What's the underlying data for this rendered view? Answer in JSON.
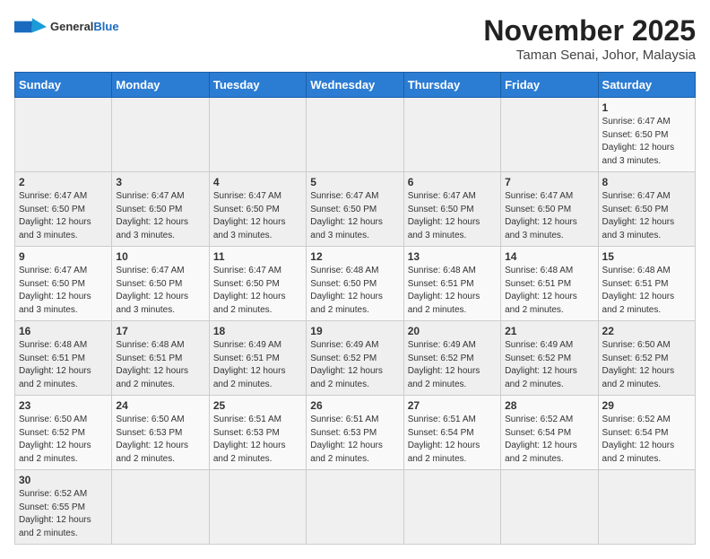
{
  "logo": {
    "text_general": "General",
    "text_blue": "Blue"
  },
  "title": {
    "month_year": "November 2025",
    "location": "Taman Senai, Johor, Malaysia"
  },
  "weekdays": [
    "Sunday",
    "Monday",
    "Tuesday",
    "Wednesday",
    "Thursday",
    "Friday",
    "Saturday"
  ],
  "weeks": [
    [
      {
        "day": "",
        "info": ""
      },
      {
        "day": "",
        "info": ""
      },
      {
        "day": "",
        "info": ""
      },
      {
        "day": "",
        "info": ""
      },
      {
        "day": "",
        "info": ""
      },
      {
        "day": "",
        "info": ""
      },
      {
        "day": "1",
        "info": "Sunrise: 6:47 AM\nSunset: 6:50 PM\nDaylight: 12 hours and 3 minutes."
      }
    ],
    [
      {
        "day": "2",
        "info": "Sunrise: 6:47 AM\nSunset: 6:50 PM\nDaylight: 12 hours and 3 minutes."
      },
      {
        "day": "3",
        "info": "Sunrise: 6:47 AM\nSunset: 6:50 PM\nDaylight: 12 hours and 3 minutes."
      },
      {
        "day": "4",
        "info": "Sunrise: 6:47 AM\nSunset: 6:50 PM\nDaylight: 12 hours and 3 minutes."
      },
      {
        "day": "5",
        "info": "Sunrise: 6:47 AM\nSunset: 6:50 PM\nDaylight: 12 hours and 3 minutes."
      },
      {
        "day": "6",
        "info": "Sunrise: 6:47 AM\nSunset: 6:50 PM\nDaylight: 12 hours and 3 minutes."
      },
      {
        "day": "7",
        "info": "Sunrise: 6:47 AM\nSunset: 6:50 PM\nDaylight: 12 hours and 3 minutes."
      },
      {
        "day": "8",
        "info": "Sunrise: 6:47 AM\nSunset: 6:50 PM\nDaylight: 12 hours and 3 minutes."
      }
    ],
    [
      {
        "day": "9",
        "info": "Sunrise: 6:47 AM\nSunset: 6:50 PM\nDaylight: 12 hours and 3 minutes."
      },
      {
        "day": "10",
        "info": "Sunrise: 6:47 AM\nSunset: 6:50 PM\nDaylight: 12 hours and 3 minutes."
      },
      {
        "day": "11",
        "info": "Sunrise: 6:47 AM\nSunset: 6:50 PM\nDaylight: 12 hours and 2 minutes."
      },
      {
        "day": "12",
        "info": "Sunrise: 6:48 AM\nSunset: 6:50 PM\nDaylight: 12 hours and 2 minutes."
      },
      {
        "day": "13",
        "info": "Sunrise: 6:48 AM\nSunset: 6:51 PM\nDaylight: 12 hours and 2 minutes."
      },
      {
        "day": "14",
        "info": "Sunrise: 6:48 AM\nSunset: 6:51 PM\nDaylight: 12 hours and 2 minutes."
      },
      {
        "day": "15",
        "info": "Sunrise: 6:48 AM\nSunset: 6:51 PM\nDaylight: 12 hours and 2 minutes."
      }
    ],
    [
      {
        "day": "16",
        "info": "Sunrise: 6:48 AM\nSunset: 6:51 PM\nDaylight: 12 hours and 2 minutes."
      },
      {
        "day": "17",
        "info": "Sunrise: 6:48 AM\nSunset: 6:51 PM\nDaylight: 12 hours and 2 minutes."
      },
      {
        "day": "18",
        "info": "Sunrise: 6:49 AM\nSunset: 6:51 PM\nDaylight: 12 hours and 2 minutes."
      },
      {
        "day": "19",
        "info": "Sunrise: 6:49 AM\nSunset: 6:52 PM\nDaylight: 12 hours and 2 minutes."
      },
      {
        "day": "20",
        "info": "Sunrise: 6:49 AM\nSunset: 6:52 PM\nDaylight: 12 hours and 2 minutes."
      },
      {
        "day": "21",
        "info": "Sunrise: 6:49 AM\nSunset: 6:52 PM\nDaylight: 12 hours and 2 minutes."
      },
      {
        "day": "22",
        "info": "Sunrise: 6:50 AM\nSunset: 6:52 PM\nDaylight: 12 hours and 2 minutes."
      }
    ],
    [
      {
        "day": "23",
        "info": "Sunrise: 6:50 AM\nSunset: 6:52 PM\nDaylight: 12 hours and 2 minutes."
      },
      {
        "day": "24",
        "info": "Sunrise: 6:50 AM\nSunset: 6:53 PM\nDaylight: 12 hours and 2 minutes."
      },
      {
        "day": "25",
        "info": "Sunrise: 6:51 AM\nSunset: 6:53 PM\nDaylight: 12 hours and 2 minutes."
      },
      {
        "day": "26",
        "info": "Sunrise: 6:51 AM\nSunset: 6:53 PM\nDaylight: 12 hours and 2 minutes."
      },
      {
        "day": "27",
        "info": "Sunrise: 6:51 AM\nSunset: 6:54 PM\nDaylight: 12 hours and 2 minutes."
      },
      {
        "day": "28",
        "info": "Sunrise: 6:52 AM\nSunset: 6:54 PM\nDaylight: 12 hours and 2 minutes."
      },
      {
        "day": "29",
        "info": "Sunrise: 6:52 AM\nSunset: 6:54 PM\nDaylight: 12 hours and 2 minutes."
      }
    ],
    [
      {
        "day": "30",
        "info": "Sunrise: 6:52 AM\nSunset: 6:55 PM\nDaylight: 12 hours and 2 minutes."
      },
      {
        "day": "",
        "info": ""
      },
      {
        "day": "",
        "info": ""
      },
      {
        "day": "",
        "info": ""
      },
      {
        "day": "",
        "info": ""
      },
      {
        "day": "",
        "info": ""
      },
      {
        "day": "",
        "info": ""
      }
    ]
  ]
}
